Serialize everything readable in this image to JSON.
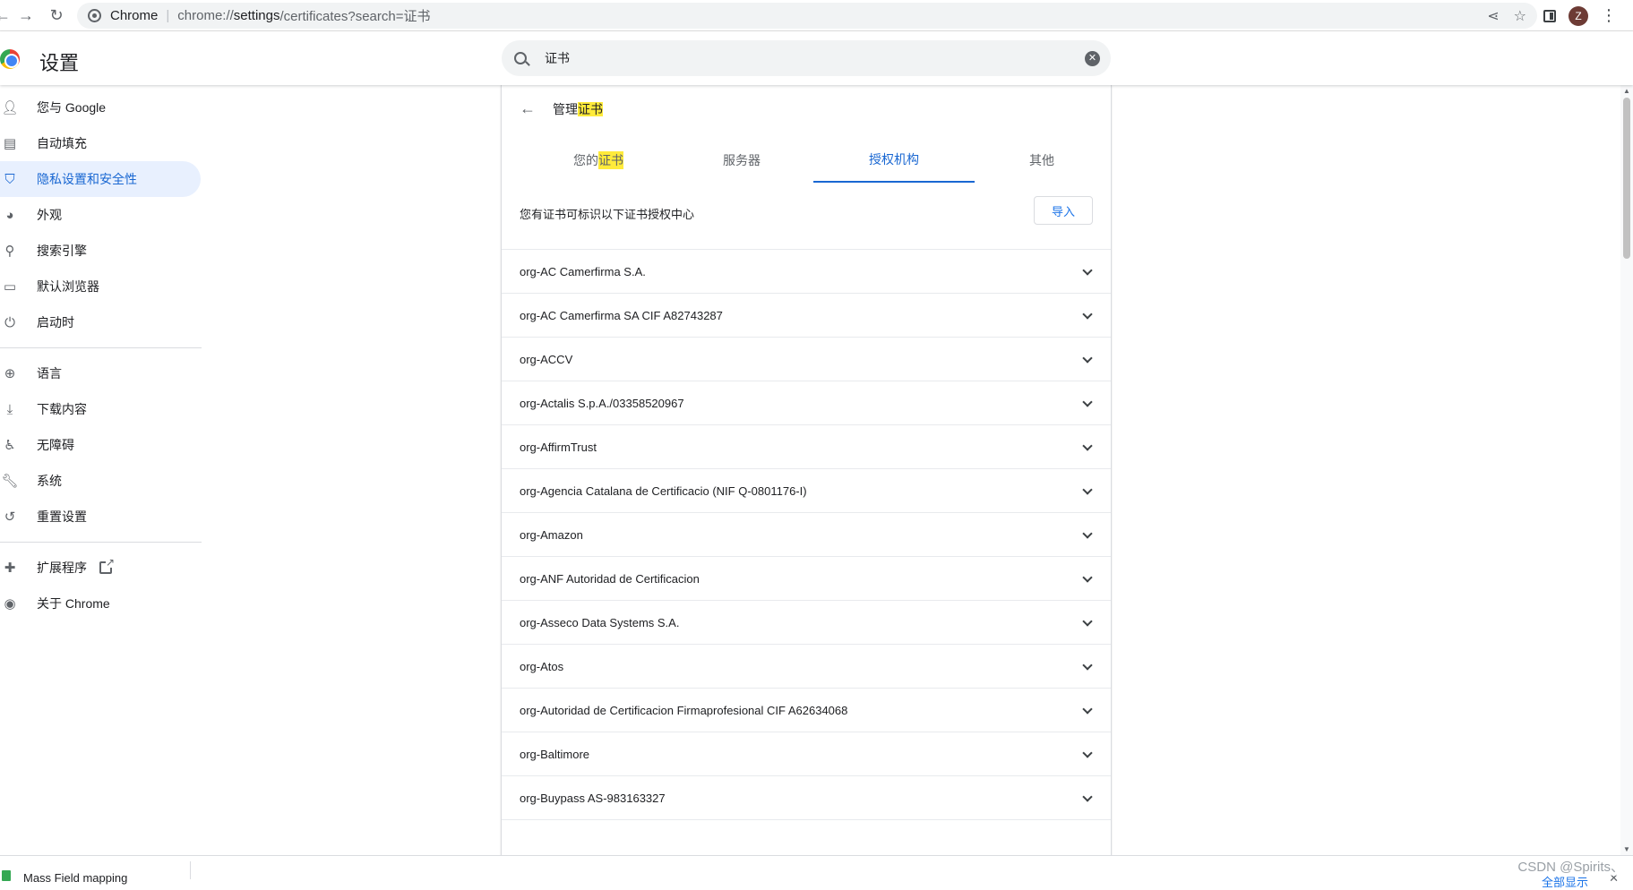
{
  "browser": {
    "tab_name": "Chrome",
    "url_dim": "chrome://",
    "url_host": "settings",
    "url_rest": "/certificates?search=证书",
    "profile_initial": "Z"
  },
  "header": {
    "title": "设置",
    "search_value": "证书"
  },
  "sidebar": {
    "items": [
      {
        "label": "您与 Google",
        "icon": "person-icon"
      },
      {
        "label": "自动填充",
        "icon": "clipboard-icon"
      },
      {
        "label": "隐私设置和安全性",
        "icon": "shield-icon"
      },
      {
        "label": "外观",
        "icon": "palette-icon"
      },
      {
        "label": "搜索引擎",
        "icon": "search-icon"
      },
      {
        "label": "默认浏览器",
        "icon": "browser-icon"
      },
      {
        "label": "启动时",
        "icon": "power-icon"
      },
      {
        "label": "语言",
        "icon": "globe-icon"
      },
      {
        "label": "下载内容",
        "icon": "download-icon"
      },
      {
        "label": "无障碍",
        "icon": "accessibility-icon"
      },
      {
        "label": "系统",
        "icon": "wrench-icon"
      },
      {
        "label": "重置设置",
        "icon": "restore-icon"
      },
      {
        "label": "扩展程序",
        "icon": "puzzle-icon"
      },
      {
        "label": "关于 Chrome",
        "icon": "chrome-icon"
      }
    ],
    "active_index": 2
  },
  "subpage": {
    "title_prefix": "管理",
    "title_highlight": "证书"
  },
  "tabs": [
    {
      "label_prefix": "您的",
      "label_highlight": "证书"
    },
    {
      "label": "服务器"
    },
    {
      "label": "授权机构"
    },
    {
      "label": "其他"
    }
  ],
  "selected_tab": 2,
  "import_section": {
    "description": "您有证书可标识以下证书授权中心",
    "button_label": "导入"
  },
  "certificates": [
    "org-AC Camerfirma S.A.",
    "org-AC Camerfirma SA CIF A82743287",
    "org-ACCV",
    "org-Actalis S.p.A./03358520967",
    "org-AffirmTrust",
    "org-Agencia Catalana de Certificacio (NIF Q-0801176-I)",
    "org-Amazon",
    "org-ANF Autoridad de Certificacion",
    "org-Asseco Data Systems S.A.",
    "org-Atos",
    "org-Autoridad de Certificacion Firmaprofesional CIF A62634068",
    "org-Baltimore",
    "org-Buypass AS-983163327"
  ],
  "download_bar": {
    "file_name": "Mass Field mapping",
    "show_all": "全部显示"
  },
  "watermark": "CSDN @Spirits、",
  "colors": {
    "accent": "#1967d2",
    "highlight": "#ffeb3b",
    "active_nav_bg": "#e8f0fe"
  }
}
